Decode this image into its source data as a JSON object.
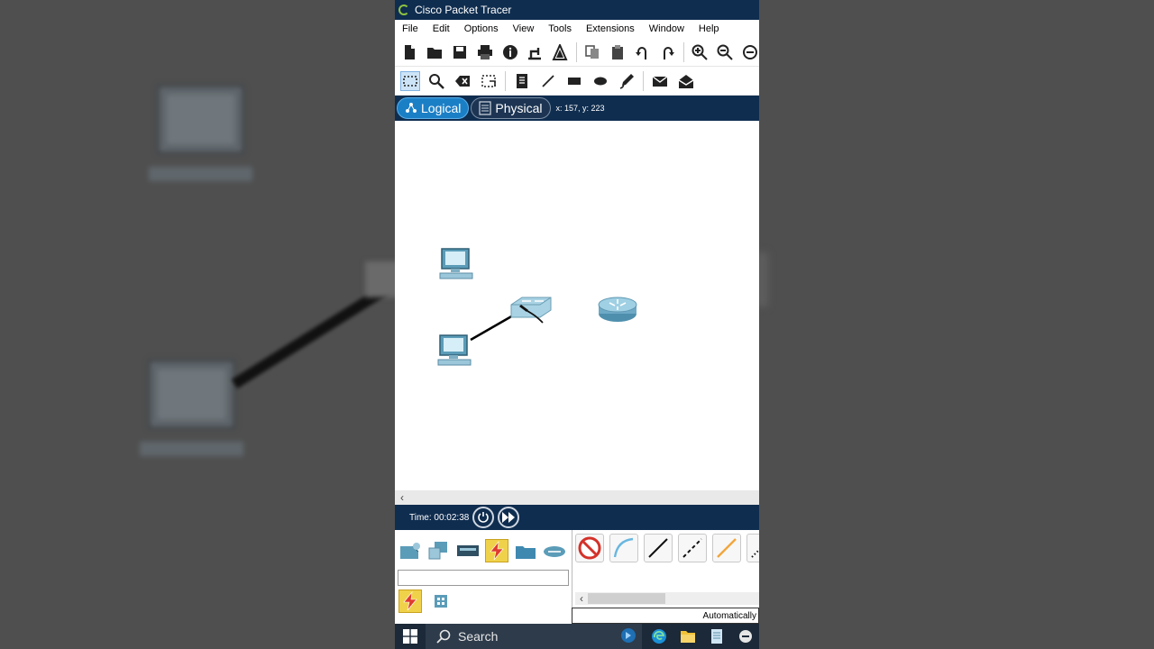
{
  "window": {
    "title": "Cisco Packet Tracer"
  },
  "menu": [
    "File",
    "Edit",
    "Options",
    "View",
    "Tools",
    "Extensions",
    "Window",
    "Help"
  ],
  "view_tabs": {
    "logical": "Logical",
    "physical": "Physical"
  },
  "cursor_coords": "x: 157, y: 223",
  "simulation": {
    "time_label": "Time: 00:02:38"
  },
  "connection_panel": {
    "status": "Automatically"
  },
  "taskbar": {
    "search_label": "Search"
  },
  "colors": {
    "title_bar": "#0f2d4f",
    "logical_tab": "#1b7fc6",
    "selected_category": "#f0d24a",
    "device_blue": "#5b9cb8"
  },
  "canvas_devices": [
    {
      "type": "pc",
      "icon": "pc-icon"
    },
    {
      "type": "pc",
      "icon": "pc-icon"
    },
    {
      "type": "switch",
      "icon": "switch-icon"
    },
    {
      "type": "router",
      "icon": "router-icon"
    }
  ],
  "canvas_links": [
    {
      "from": "pc-2",
      "to": "switch-1",
      "style": "solid-black"
    }
  ]
}
